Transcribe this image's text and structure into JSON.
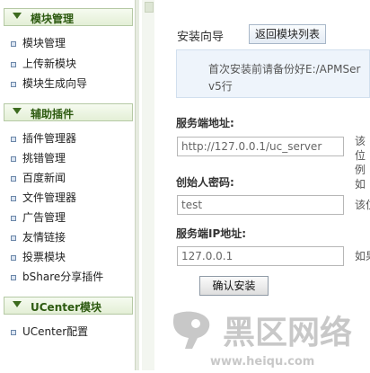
{
  "sidebar": {
    "sections": [
      {
        "title": "模块管理",
        "items": [
          "模块管理",
          "上传新模块",
          "模块生成向导"
        ]
      },
      {
        "title": "辅助插件",
        "items": [
          "插件管理器",
          "挑错管理",
          "百度新闻",
          "文件管理器",
          "广告管理",
          "友情链接",
          "投票模块",
          "bShare分享插件"
        ]
      },
      {
        "title": "UCenter模块",
        "items": [
          "UCenter配置"
        ]
      }
    ]
  },
  "main": {
    "title": "安装向导",
    "back_button": "返回模块列表",
    "notice": "首次安装前请备份好E:/APMServ5行",
    "fields": [
      {
        "label": "服务端地址:",
        "value": "http://127.0.0.1/uc_server",
        "hint": "该位例如"
      },
      {
        "label": "创始人密码:",
        "value": "test",
        "hint": "该位"
      },
      {
        "label": "服务端IP地址:",
        "value": "127.0.0.1",
        "hint": "如果"
      }
    ],
    "submit": "确认安装"
  },
  "watermark": {
    "text": "黑区网络",
    "url": "www.heiqu.com"
  },
  "colors": {
    "section_header_text": "#2d5a10",
    "notice_bg": "#eef4fb",
    "watermark": "#c8c8c8"
  }
}
